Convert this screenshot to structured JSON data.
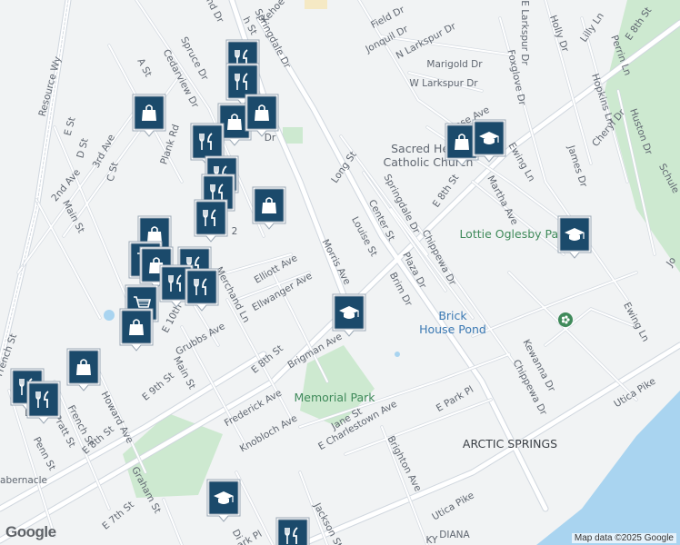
{
  "map": {
    "attribution": "Map data ©2025 Google",
    "logo": "Google",
    "colors": {
      "background": "#f1f3f4",
      "road": "#ffffff",
      "road_edge": "#cfd6de",
      "water": "#a9d4f0",
      "park": "#cde9d0",
      "label": "#5f6670",
      "poi_label": "#3f8a5a",
      "pin": "#1b4a6b"
    },
    "labels": [
      {
        "id": "kehoe-ln",
        "text": "Kehoe Ln"
      },
      {
        "id": "field-dr",
        "text": "Field Dr"
      },
      {
        "id": "jonquil-dr",
        "text": "Jonquil Dr"
      },
      {
        "id": "n-larkspur-dr",
        "text": "N Larkspur Dr"
      },
      {
        "id": "e-larkspur-dr",
        "text": "E Larkspur Dr"
      },
      {
        "id": "holly-dr",
        "text": "Holly Dr"
      },
      {
        "id": "lilly-ln",
        "text": "Lilly Ln"
      },
      {
        "id": "perrin-ln",
        "text": "Perrin Ln"
      },
      {
        "id": "e-8th-st-ne",
        "text": "E 8th St"
      },
      {
        "id": "springdale-dr-n",
        "text": "Springdale Dr"
      },
      {
        "id": "marigold-dr",
        "text": "Marigold Dr"
      },
      {
        "id": "w-larkspur-dr",
        "text": "W Larkspur Dr"
      },
      {
        "id": "foxglove-dr",
        "text": "Foxglove Dr"
      },
      {
        "id": "hopkins-ln",
        "text": "Hopkins Ln"
      },
      {
        "id": "huston-dr",
        "text": "Huston Dr"
      },
      {
        "id": "resource-wy",
        "text": "Resource Wy"
      },
      {
        "id": "spruce-dr",
        "text": "Spruce Dr"
      },
      {
        "id": "cedarview-dr",
        "text": "Cedarview Dr"
      },
      {
        "id": "a-st",
        "text": "A St"
      },
      {
        "id": "rose-ave",
        "text": "Rose Ave"
      },
      {
        "id": "cheryl-dr",
        "text": "Cheryl Dr"
      },
      {
        "id": "ewing-ln-n",
        "text": "Ewing Ln"
      },
      {
        "id": "plank-rd",
        "text": "Plank Rd"
      },
      {
        "id": "e-st",
        "text": "E St"
      },
      {
        "id": "d-st",
        "text": "D St"
      },
      {
        "id": "3rd-ave",
        "text": "3rd Ave"
      },
      {
        "id": "c-st",
        "text": "C St"
      },
      {
        "id": "long-st",
        "text": "Long St"
      },
      {
        "id": "martha-ave",
        "text": "Martha Ave"
      },
      {
        "id": "james-dr",
        "text": "James Dr"
      },
      {
        "id": "schuler",
        "text": "Schule"
      },
      {
        "id": "2nd-ave",
        "text": "2nd Ave"
      },
      {
        "id": "springdale-dr-s",
        "text": "Springdale Dr"
      },
      {
        "id": "e-8th-st-mid",
        "text": "E 8th St"
      },
      {
        "id": "main-st-n",
        "text": "Main St"
      },
      {
        "id": "center-st",
        "text": "Center St"
      },
      {
        "id": "louise-st",
        "text": "Louise St"
      },
      {
        "id": "chippewa-dr-n",
        "text": "Chippewa Dr"
      },
      {
        "id": "morris-ave",
        "text": "Morris Ave"
      },
      {
        "id": "plaza-dr",
        "text": "Plaza Dr"
      },
      {
        "id": "elliott-ave",
        "text": "Elliott Ave"
      },
      {
        "id": "brim-dr",
        "text": "Brim Dr"
      },
      {
        "id": "ellwanger-ave",
        "text": "Ellwanger Ave"
      },
      {
        "id": "merchand-ln",
        "text": "Merchand Ln"
      },
      {
        "id": "e-10th",
        "text": "E 10th"
      },
      {
        "id": "ewing-ln-s",
        "text": "Ewing Ln"
      },
      {
        "id": "jo",
        "text": "Jo"
      },
      {
        "id": "grubbs-ave",
        "text": "Grubbs Ave"
      },
      {
        "id": "french-st-n",
        "text": "French St"
      },
      {
        "id": "brigman-ave",
        "text": "Brigman Ave"
      },
      {
        "id": "kewanna-dr",
        "text": "Kewanna Dr"
      },
      {
        "id": "chippewa-dr-s",
        "text": "Chippewa Dr"
      },
      {
        "id": "e-8th-st-sw",
        "text": "E 8th St"
      },
      {
        "id": "e-9th-st",
        "text": "E 9th St"
      },
      {
        "id": "main-st-s",
        "text": "Main St"
      },
      {
        "id": "utica-pike-e",
        "text": "Utica Pike"
      },
      {
        "id": "howard-ave",
        "text": "Howard Ave"
      },
      {
        "id": "frederick-ave",
        "text": "Frederick Ave"
      },
      {
        "id": "e-park-pl",
        "text": "E Park Pl"
      },
      {
        "id": "e-charlestown-ave",
        "text": "E Charlestown Ave"
      },
      {
        "id": "jane-st",
        "text": "Jane St"
      },
      {
        "id": "french-st-s",
        "text": "French St"
      },
      {
        "id": "pratt-st",
        "text": "Pratt St"
      },
      {
        "id": "penn-st",
        "text": "Penn St"
      },
      {
        "id": "knobloch-ave",
        "text": "Knobloch Ave"
      },
      {
        "id": "e-8th-st-w",
        "text": "E 8th St"
      },
      {
        "id": "brighton-ave",
        "text": "Brighton Ave"
      },
      {
        "id": "utica-pike-w",
        "text": "Utica Pike"
      },
      {
        "id": "graham-st",
        "text": "Graham St"
      },
      {
        "id": "tabernacle",
        "text": "abernacle"
      },
      {
        "id": "e-7th-st",
        "text": "E 7th St"
      },
      {
        "id": "jackson-st",
        "text": "Jackson St"
      },
      {
        "id": "ark-pl",
        "text": "ark Pl"
      },
      {
        "id": "diana",
        "text": "DIANA"
      },
      {
        "id": "ky",
        "text": "KY"
      },
      {
        "id": "ch-st",
        "text": "h St"
      },
      {
        "id": "and-dr",
        "text": "and Dr"
      },
      {
        "id": "dr-small",
        "text": "Dr"
      },
      {
        "id": "di",
        "text": "Di"
      },
      {
        "id": "two",
        "text": "2"
      },
      {
        "id": "l-st",
        "text": "L"
      }
    ],
    "pois": [
      {
        "id": "sacred-heart",
        "text": "Sacred Heart\nCatholic Church"
      },
      {
        "id": "lottie-oglesby-park",
        "text": "Lottie Oglesby Park"
      },
      {
        "id": "brick-house-pond",
        "text": "Brick\nHouse Pond"
      },
      {
        "id": "memorial-park",
        "text": "Memorial Park"
      },
      {
        "id": "arctic-springs",
        "text": "ARCTIC SPRINGS"
      }
    ],
    "pins": [
      {
        "id": "pin-1",
        "icon": "restaurant-icon"
      },
      {
        "id": "pin-2",
        "icon": "restaurant-icon"
      },
      {
        "id": "pin-3",
        "icon": "shopping-bag-icon"
      },
      {
        "id": "pin-4",
        "icon": "shopping-bag-icon"
      },
      {
        "id": "pin-5",
        "icon": "shopping-bag-icon"
      },
      {
        "id": "pin-6",
        "icon": "restaurant-icon"
      },
      {
        "id": "pin-7",
        "icon": "restaurant-icon"
      },
      {
        "id": "pin-8",
        "icon": "restaurant-icon"
      },
      {
        "id": "pin-9",
        "icon": "restaurant-icon"
      },
      {
        "id": "pin-10",
        "icon": "shopping-bag-icon"
      },
      {
        "id": "pin-11",
        "icon": "shopping-bag-icon"
      },
      {
        "id": "pin-12",
        "icon": "shopping-cart-icon"
      },
      {
        "id": "pin-13",
        "icon": "shopping-bag-icon"
      },
      {
        "id": "pin-14",
        "icon": "restaurant-icon"
      },
      {
        "id": "pin-15",
        "icon": "restaurant-icon"
      },
      {
        "id": "pin-16",
        "icon": "restaurant-icon"
      },
      {
        "id": "pin-17",
        "icon": "shopping-cart-icon"
      },
      {
        "id": "pin-18",
        "icon": "shopping-bag-icon"
      },
      {
        "id": "pin-19",
        "icon": "shopping-bag-icon"
      },
      {
        "id": "pin-20",
        "icon": "restaurant-icon"
      },
      {
        "id": "pin-21",
        "icon": "restaurant-icon"
      },
      {
        "id": "pin-22",
        "icon": "shopping-bag-icon"
      },
      {
        "id": "pin-23",
        "icon": "school-icon"
      },
      {
        "id": "pin-24",
        "icon": "school-icon"
      },
      {
        "id": "pin-25",
        "icon": "school-icon"
      },
      {
        "id": "pin-26",
        "icon": "school-icon"
      },
      {
        "id": "pin-27",
        "icon": "restaurant-icon"
      }
    ]
  }
}
